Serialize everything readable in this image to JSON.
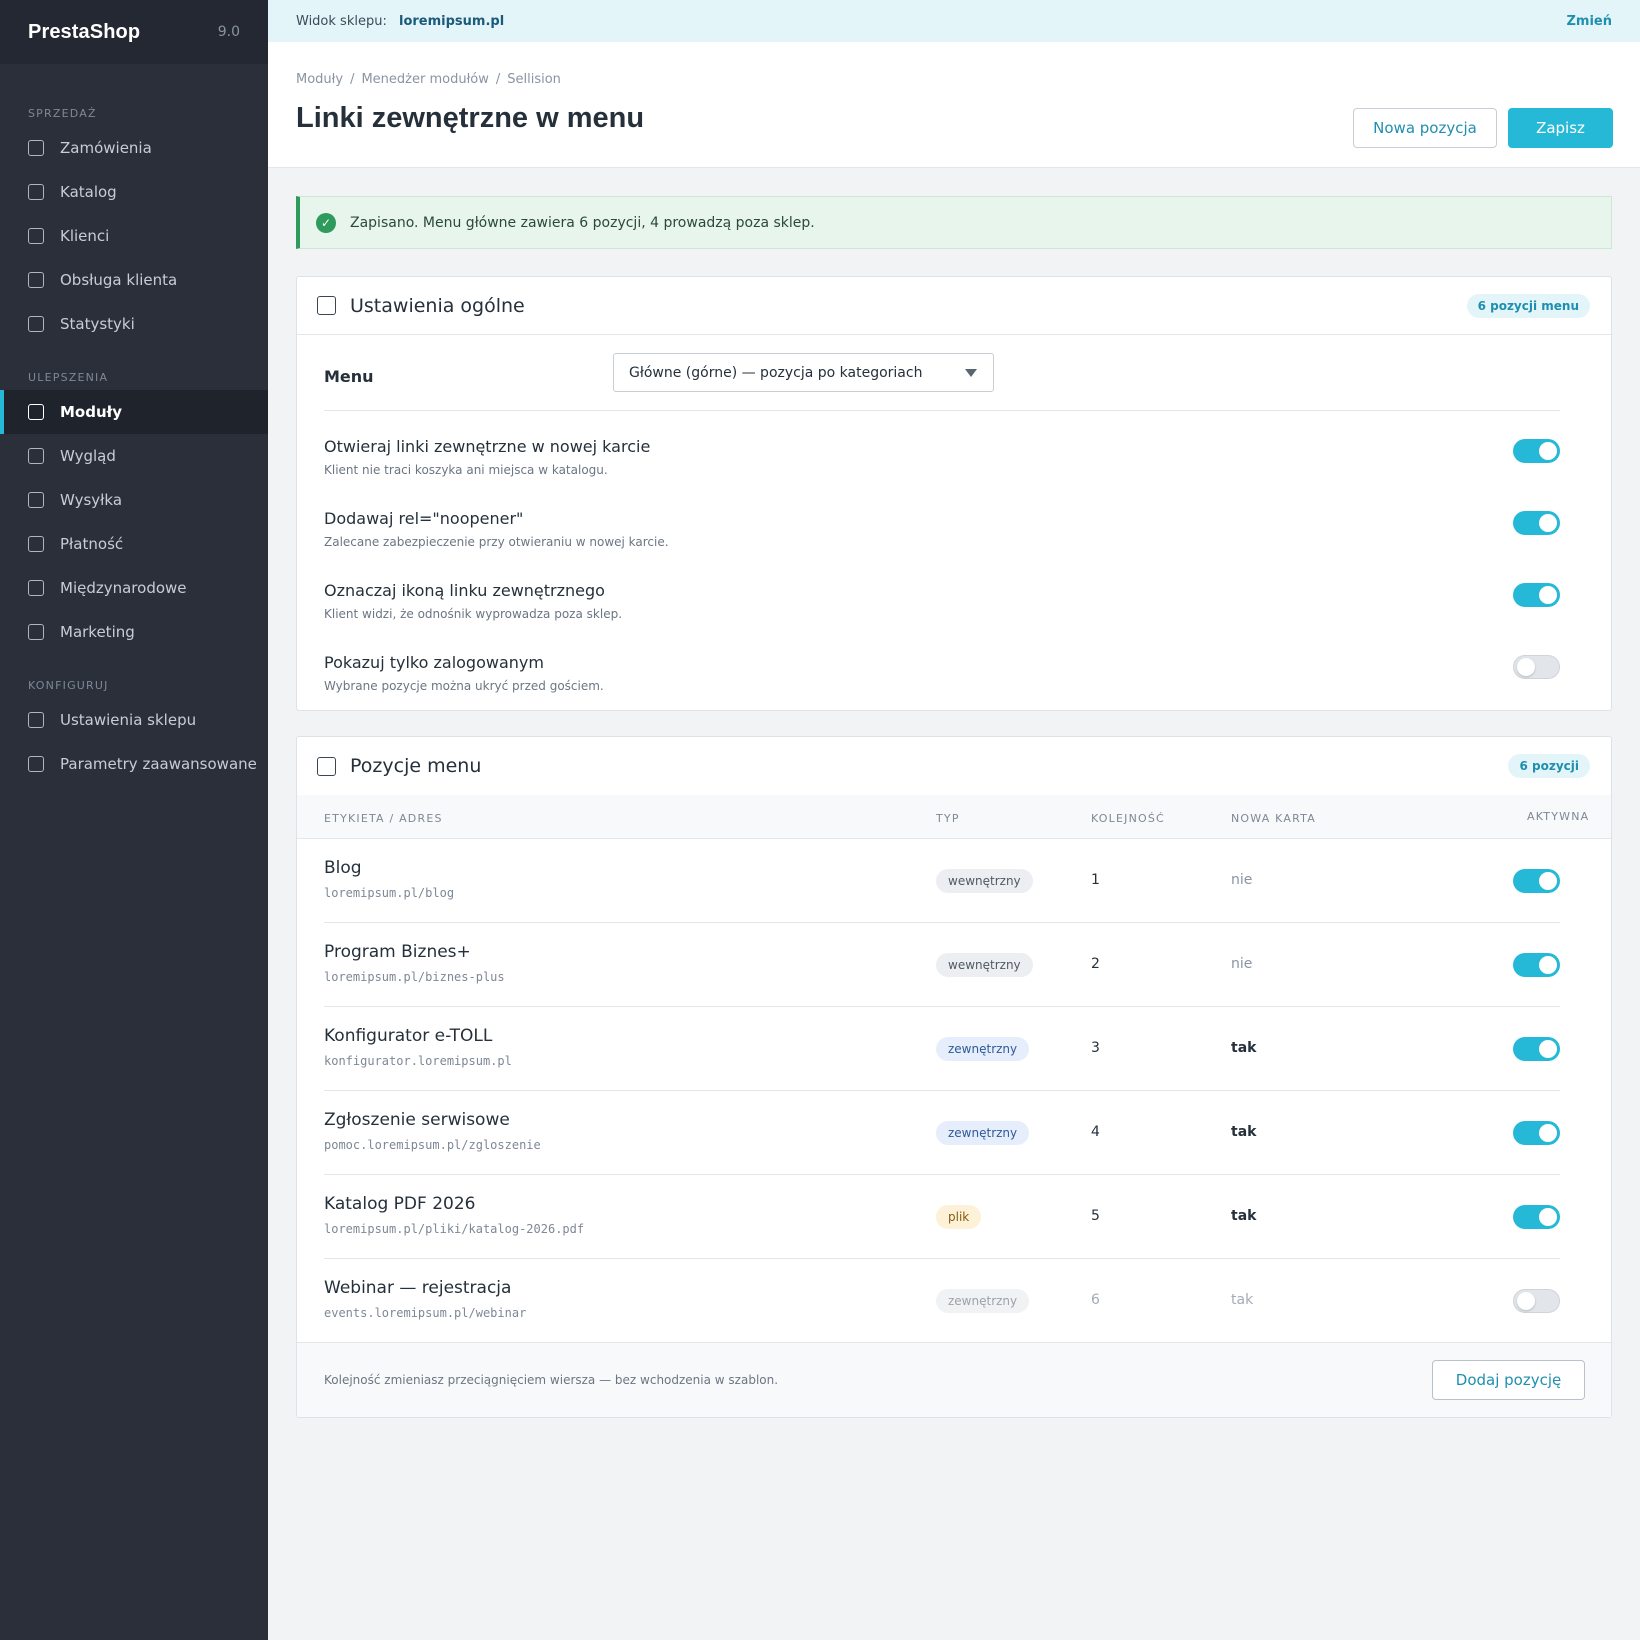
{
  "brand": {
    "name": "PrestaShop",
    "version": "9.0"
  },
  "sidebar": {
    "sections": [
      {
        "title": "SPRZEDAŻ",
        "items": [
          "Zamówienia",
          "Katalog",
          "Klienci",
          "Obsługa klienta",
          "Statystyki"
        ]
      },
      {
        "title": "ULEPSZENIA",
        "items": [
          "Moduły",
          "Wygląd",
          "Wysyłka",
          "Płatność",
          "Międzynarodowe",
          "Marketing"
        ]
      },
      {
        "title": "KONFIGURUJ",
        "items": [
          "Ustawienia sklepu",
          "Parametry zaawansowane"
        ]
      }
    ],
    "active": "Moduły"
  },
  "topbar": {
    "label": "Widok sklepu:",
    "shop": "loremipsum.pl",
    "change": "Zmień"
  },
  "header": {
    "breadcrumb": [
      "Moduły",
      "Menedżer modułów",
      "Sellision"
    ],
    "title": "Linki zewnętrzne w menu",
    "new_button": "Nowa pozycja",
    "save_button": "Zapisz"
  },
  "alert": {
    "text": "Zapisano. Menu główne zawiera 6 pozycji, 4 prowadzą poza sklep."
  },
  "general": {
    "title": "Ustawienia ogólne",
    "badge": "6 pozycji menu",
    "menu_label": "Menu",
    "menu_value": "Główne (górne) — pozycja po kategoriach",
    "options": [
      {
        "title": "Otwieraj linki zewnętrzne w nowej karcie",
        "desc": "Klient nie traci koszyka ani miejsca w katalogu.",
        "on": true
      },
      {
        "title": "Dodawaj rel=\"noopener\"",
        "desc": "Zalecane zabezpieczenie przy otwieraniu w nowej karcie.",
        "on": true
      },
      {
        "title": "Oznaczaj ikoną linku zewnętrznego",
        "desc": "Klient widzi, że odnośnik wyprowadza poza sklep.",
        "on": true
      },
      {
        "title": "Pokazuj tylko zalogowanym",
        "desc": "Wybrane pozycje można ukryć przed gościem.",
        "on": false
      }
    ]
  },
  "items_card": {
    "title": "Pozycje menu",
    "badge": "6 pozycji",
    "columns": [
      "ETYKIETA / ADRES",
      "TYP",
      "KOLEJNOŚĆ",
      "NOWA KARTA",
      "AKTYWNA"
    ],
    "rows": [
      {
        "name": "Blog",
        "url": "loremipsum.pl/blog",
        "type": "wewnętrzny",
        "order": "1",
        "new_tab": "nie",
        "active": true
      },
      {
        "name": "Program Biznes+",
        "url": "loremipsum.pl/biznes-plus",
        "type": "wewnętrzny",
        "order": "2",
        "new_tab": "nie",
        "active": true
      },
      {
        "name": "Konfigurator e-TOLL",
        "url": "konfigurator.loremipsum.pl",
        "type": "zewnętrzny",
        "order": "3",
        "new_tab": "tak",
        "active": true
      },
      {
        "name": "Zgłoszenie serwisowe",
        "url": "pomoc.loremipsum.pl/zgloszenie",
        "type": "zewnętrzny",
        "order": "4",
        "new_tab": "tak",
        "active": true
      },
      {
        "name": "Katalog PDF 2026",
        "url": "loremipsum.pl/pliki/katalog-2026.pdf",
        "type": "plik",
        "order": "5",
        "new_tab": "tak",
        "active": true
      },
      {
        "name": "Webinar — rejestracja",
        "url": "events.loremipsum.pl/webinar",
        "type": "zewnętrzny",
        "order": "6",
        "new_tab": "tak",
        "active": false
      }
    ],
    "footer_note": "Kolejność zmieniasz przeciągnięciem wiersza — bez wchodzenia w szablon.",
    "add_button": "Dodaj pozycję"
  },
  "colors": {
    "accent": "#25b9d7",
    "sidebar": "#2a2f3a",
    "success": "#2e9b5c"
  }
}
